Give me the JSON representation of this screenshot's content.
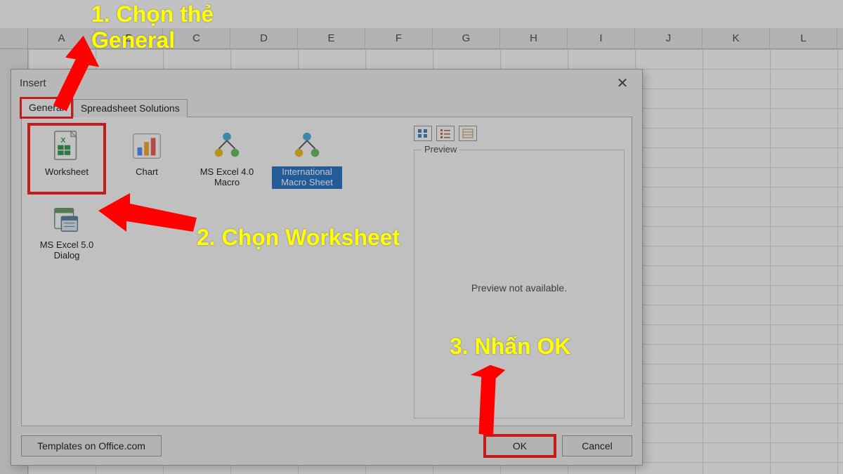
{
  "columns": [
    "A",
    "B",
    "C",
    "D",
    "E",
    "F",
    "G",
    "H",
    "I",
    "J",
    "K",
    "L"
  ],
  "dialog": {
    "title": "Insert",
    "close_glyph": "✕",
    "tabs": {
      "general": "General",
      "solutions": "Spreadsheet Solutions"
    },
    "templates": {
      "worksheet": "Worksheet",
      "chart": "Chart",
      "macro4": "MS Excel 4.0 Macro",
      "intl_macro": "International Macro Sheet",
      "dialog5": "MS Excel 5.0 Dialog"
    },
    "preview_label": "Preview",
    "preview_msg": "Preview not available.",
    "templates_link": "Templates on Office.com",
    "ok": "OK",
    "cancel": "Cancel"
  },
  "annotations": {
    "step1": "1. Chọn thẻ\nGeneral",
    "step2": "2. Chọn Worksheet",
    "step3": "3. Nhấn OK"
  }
}
